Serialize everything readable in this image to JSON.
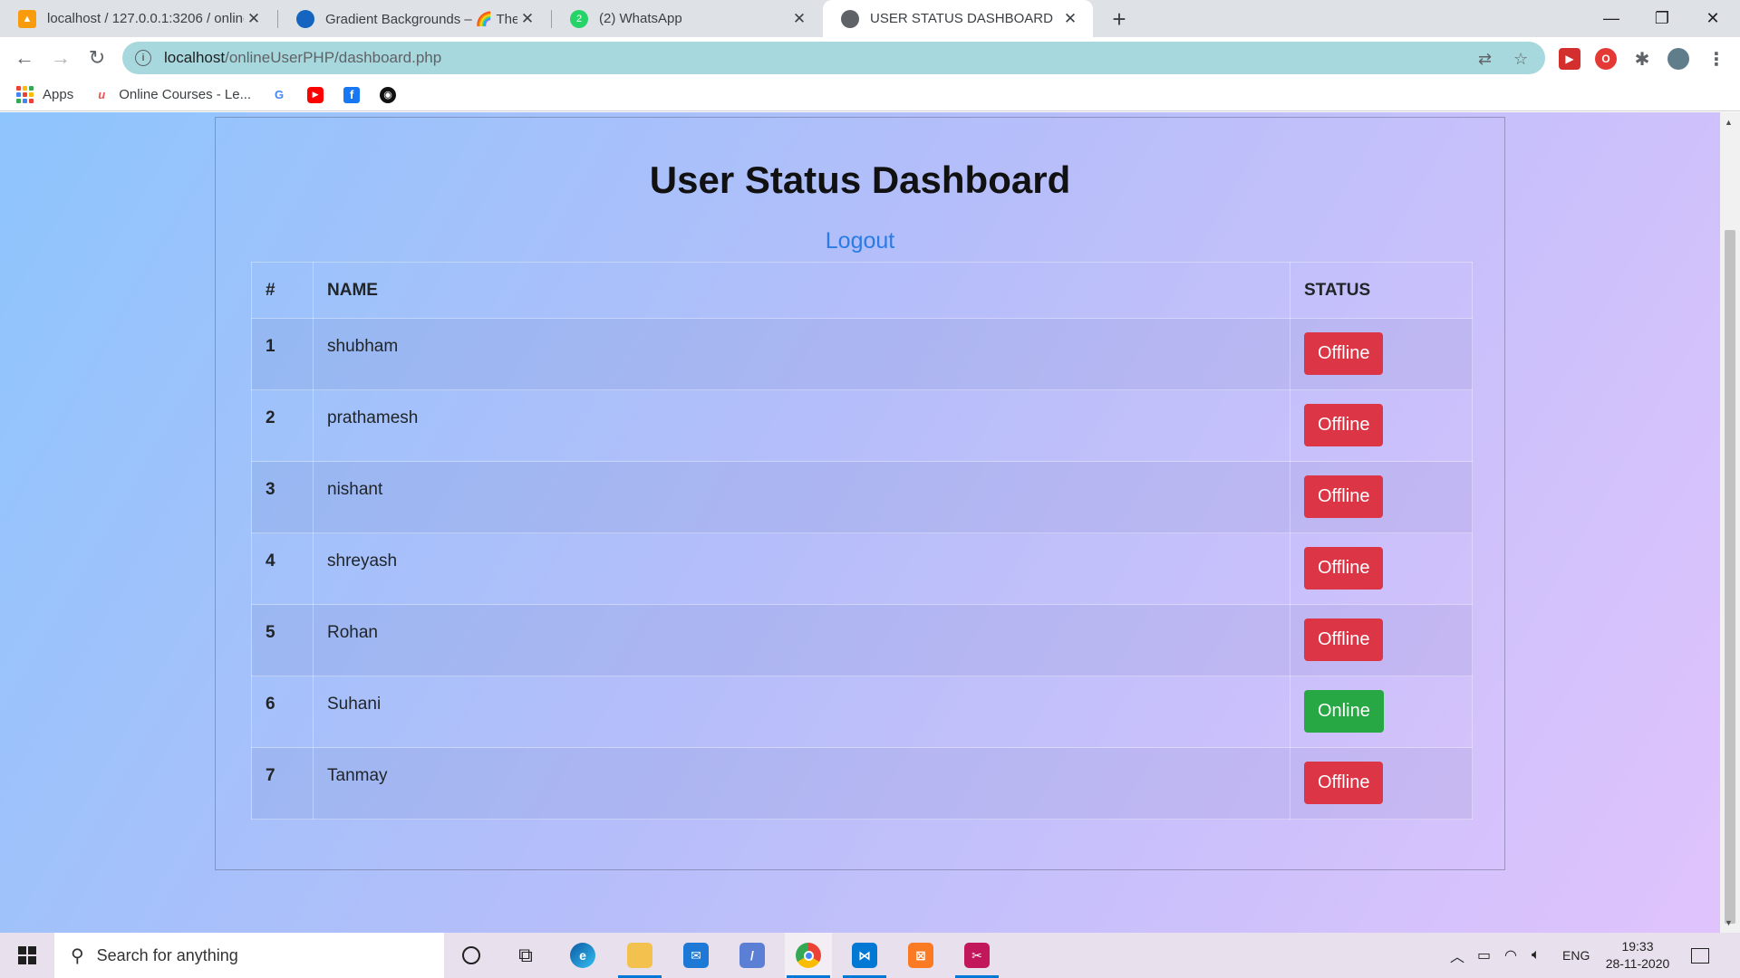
{
  "browser": {
    "tabs": [
      {
        "title": "localhost / 127.0.0.1:3206 / online",
        "icon": "phpmyadmin-icon"
      },
      {
        "title": "Gradient Backgrounds – 🌈 The ",
        "icon": "globe-blue-icon"
      },
      {
        "title": "(2) WhatsApp",
        "icon": "whatsapp-icon"
      },
      {
        "title": "USER STATUS DASHBOARD",
        "icon": "globe-icon"
      }
    ],
    "active_tab": 3,
    "url_host": "localhost",
    "url_path": "/onlineUserPHP/dashboard.php",
    "bookmarks": [
      {
        "label": "Apps",
        "icon": "apps-grid-icon"
      },
      {
        "label": "Online Courses - Le...",
        "icon": "udemy-icon"
      },
      {
        "label": "",
        "icon": "google-icon"
      },
      {
        "label": "",
        "icon": "youtube-icon"
      },
      {
        "label": "",
        "icon": "facebook-icon"
      },
      {
        "label": "",
        "icon": "github-icon"
      }
    ]
  },
  "page": {
    "title": "User Status Dashboard",
    "logout_label": "Logout",
    "table": {
      "headers": [
        "#",
        "NAME",
        "STATUS"
      ],
      "rows": [
        {
          "num": "1",
          "name": "shubham",
          "status": "Offline"
        },
        {
          "num": "2",
          "name": "prathamesh",
          "status": "Offline"
        },
        {
          "num": "3",
          "name": "nishant",
          "status": "Offline"
        },
        {
          "num": "4",
          "name": "shreyash",
          "status": "Offline"
        },
        {
          "num": "5",
          "name": "Rohan",
          "status": "Offline"
        },
        {
          "num": "6",
          "name": "Suhani",
          "status": "Online"
        },
        {
          "num": "7",
          "name": "Tanmay",
          "status": "Offline"
        }
      ]
    },
    "colors": {
      "offline": "#dc3545",
      "online": "#28a745",
      "link": "#2a7be4"
    }
  },
  "taskbar": {
    "search_placeholder": "Search for anything",
    "language": "ENG",
    "time": "19:33",
    "date": "28-11-2020"
  }
}
